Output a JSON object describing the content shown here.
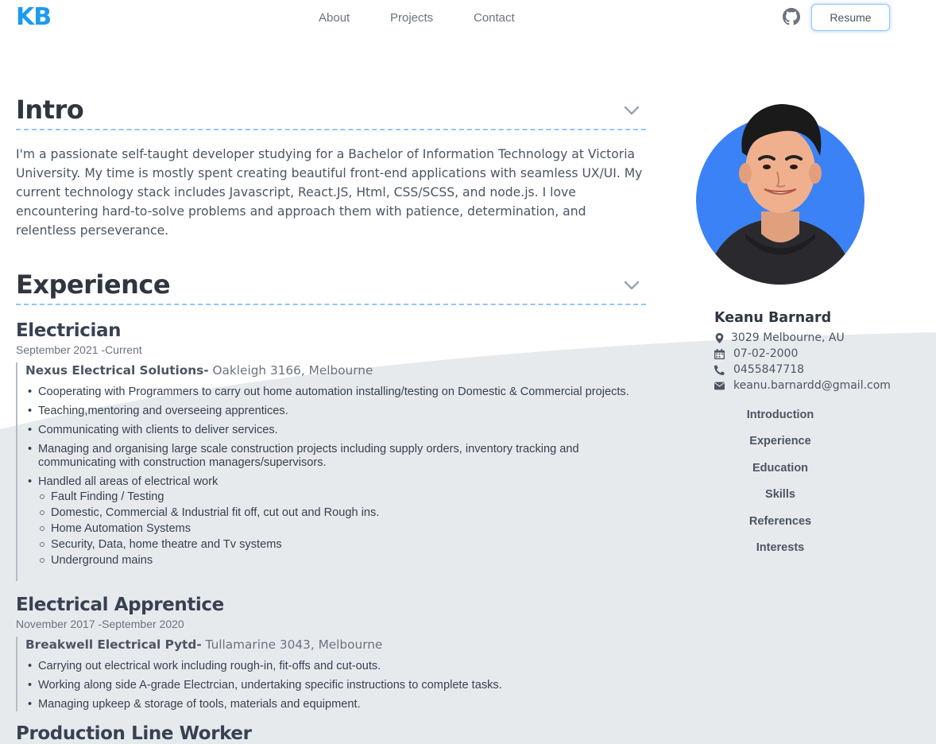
{
  "header": {
    "logo": "KB",
    "nav": [
      "About",
      "Projects",
      "Contact"
    ],
    "resume_label": "Resume"
  },
  "intro": {
    "title": "Intro",
    "text": "I'm a passionate self-taught developer studying for a Bachelor of Information Technology at Victoria University. My time is mostly spent creating beautiful front-end applications with seamless UX/UI. My current technology stack includes Javascript, React.JS, Html, CSS/SCSS, and node.js. I love encountering hard-to-solve problems and approach them with patience, determination, and relentless perseverance."
  },
  "experience": {
    "title": "Experience",
    "jobs": [
      {
        "title": "Electrician",
        "date": "September 2021 -Current",
        "company": "Nexus Electrical Solutions-",
        "location": "Oakleigh 3166, Melbourne",
        "duties": [
          "Cooperating with Programmers to carry out home automation installing/testing on Domestic & Commercial projects.",
          "Teaching,mentoring and overseeing apprentices.",
          "Communicating with clients to deliver services.",
          "Managing and organising large scale construction projects including supply orders, inventory tracking and communicating with construction managers/supervisors.",
          "Handled all areas of electrical work"
        ],
        "sub_duties": [
          "Fault Finding / Testing",
          "Domestic, Commercial & Industrial fit off, cut out and Rough ins.",
          "Home Automation Systems",
          "Security, Data, home theatre and Tv systems",
          "Underground mains"
        ]
      },
      {
        "title": "Electrical Apprentice",
        "date": "November 2017 -September 2020",
        "company": "Breakwell Electrical Pytd-",
        "location": "Tullamarine 3043, Melbourne",
        "duties": [
          "Carrying out electrical work including rough-in, fit-offs and cut-outs.",
          "Working along side A-grade Electrcian, undertaking specific instructions to complete tasks.",
          "Managing upkeep & storage of tools, materials and equipment."
        ]
      },
      {
        "title": "Production Line Worker"
      }
    ]
  },
  "profile": {
    "name": "Keanu Barnard",
    "location": "3029 Melbourne, AU",
    "dob": "07-02-2000",
    "phone": "0455847718",
    "email": "keanu.barnardd@gmail.com"
  },
  "side_nav": [
    "Introduction",
    "Experience",
    "Education",
    "Skills",
    "References",
    "Interests"
  ],
  "colors": {
    "accent": "#1d9bf0",
    "dashed_line": "#93c5fd",
    "avatar_bg": "#3b82f6",
    "wave_bg": "#e7eaed"
  },
  "icons": [
    "github-icon",
    "chevron-down-icon",
    "map-pin-icon",
    "calendar-icon",
    "phone-icon",
    "envelope-icon"
  ]
}
